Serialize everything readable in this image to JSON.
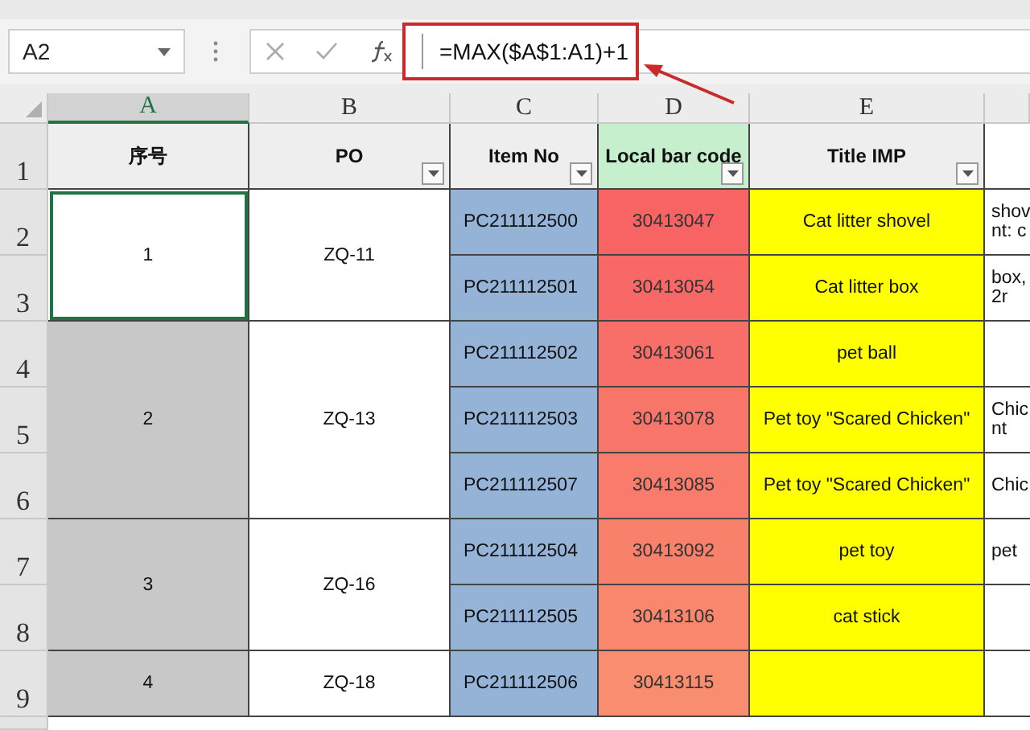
{
  "name_box": "A2",
  "formula": "=MAX($A$1:A1)+1",
  "column_headers": [
    {
      "label": "A",
      "selected": true
    },
    {
      "label": "B",
      "selected": false
    },
    {
      "label": "C",
      "selected": false
    },
    {
      "label": "D",
      "selected": false
    },
    {
      "label": "E",
      "selected": false
    }
  ],
  "header_row": {
    "row_label": "1",
    "cells": [
      {
        "text": "序号",
        "filter": false
      },
      {
        "text": "PO",
        "filter": true
      },
      {
        "text": "Item No",
        "filter": true
      },
      {
        "text": "Local bar code",
        "filter": true
      },
      {
        "text": "Title IMP",
        "filter": true
      }
    ]
  },
  "groups": [
    {
      "seq": "1",
      "po": "ZQ-11",
      "selected": true,
      "items": [
        {
          "row": "2",
          "item_no": "PC211112500",
          "barcode": "30413047",
          "color": "#f86464",
          "title": "Cat litter shovel",
          "column_f": [
            "shov",
            "nt: c"
          ]
        },
        {
          "row": "3",
          "item_no": "PC211112501",
          "barcode": "30413054",
          "color": "#f86866",
          "title": "Cat litter box",
          "column_f": [
            "box,",
            "2r"
          ]
        }
      ]
    },
    {
      "seq": "2",
      "po": "ZQ-13",
      "selected": false,
      "items": [
        {
          "row": "4",
          "item_no": "PC211112502",
          "barcode": "30413061",
          "color": "#f86e68",
          "title": "pet ball"
        },
        {
          "row": "5",
          "item_no": "PC211112503",
          "barcode": "30413078",
          "color": "#f8756a",
          "title": "Pet toy \"Scared Chicken\"",
          "column_f": [
            "Chic",
            "nt"
          ]
        },
        {
          "row": "6",
          "item_no": "PC211112507",
          "barcode": "30413085",
          "color": "#f87b6b",
          "title": "Pet toy \"Scared Chicken\"",
          "column_f": [
            "Chic"
          ]
        }
      ]
    },
    {
      "seq": "3",
      "po": "ZQ-16",
      "selected": false,
      "items": [
        {
          "row": "7",
          "item_no": "PC211112504",
          "barcode": "30413092",
          "color": "#f8816c",
          "title": "pet toy",
          "column_f": [
            "pet"
          ]
        },
        {
          "row": "8",
          "item_no": "PC211112505",
          "barcode": "30413106",
          "color": "#f8876e",
          "title": "cat stick"
        }
      ]
    },
    {
      "seq": "4",
      "po": "ZQ-18",
      "selected": false,
      "items": [
        {
          "row": "9",
          "item_no": "PC211112506",
          "barcode": "30413115",
          "color": "#f88d6f"
        }
      ]
    }
  ]
}
